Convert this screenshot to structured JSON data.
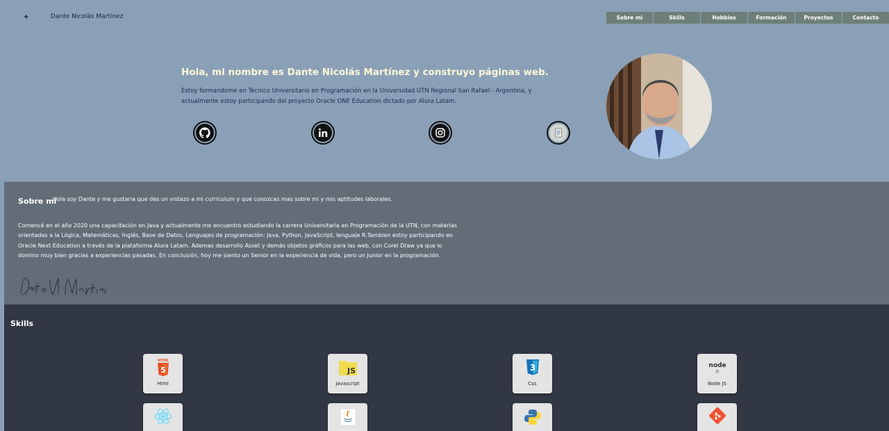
{
  "header": {
    "site_name": "Dante Nicolás Martínez",
    "logo_icon": "sparkle-icon",
    "nav": [
      {
        "label": "Sobre mi"
      },
      {
        "label": "Skills"
      },
      {
        "label": "Hobbies"
      },
      {
        "label": "Formación"
      },
      {
        "label": "Proyectos"
      },
      {
        "label": "Contacto"
      }
    ]
  },
  "hero": {
    "title": "Hola, mi nombre es Dante Nicolás Martínez y construyo páginas web.",
    "text": "Estoy formandome en Tecnico Universitario en Programación en la Universidad UTN Regional San Rafael - Argentina, y actualmente estoy participando del proyecto Oracle ONE Education dictado por Alura Latam.",
    "socials": [
      {
        "icon": "github-icon"
      },
      {
        "icon": "linkedin-icon"
      },
      {
        "icon": "instagram-icon"
      },
      {
        "icon": "resume-icon"
      }
    ],
    "avatar": "profile-photo"
  },
  "about": {
    "heading": "Sobre mi",
    "intro": "Hola soy Dante y me gustaria que des un vistazo a mi curriculum y que conozcas mas sobre mi y mis aptitudes laborales.",
    "body": "Comencé en el año 2020 una capacitación en Java y actualmente me encuentro estudiando la carrera Universitaria en Programación de la UTN, con materias orientadas a la Lógica, Matemáticas, Inglés, Base de Datos, Lenguajes de programación: Java, Python, JavaScript, lenguaje R.Tambien estoy participando en Oracle Next Education a través de la plataforma Alura Latam. Ademas desarrollo Asset y demás objetos gráficos para las web, con Corel Draw ya que lo domino muy bien gracias a experiencias pasadas. En conclusión, hoy me siento un Senior en la experiencia de vida, pero un Junior en la programación.",
    "signature": "Dante N Martinez"
  },
  "skills": {
    "heading": "Skills",
    "items": [
      {
        "label": "Html",
        "icon": "html5-icon"
      },
      {
        "label": "Javascript",
        "icon": "javascript-icon"
      },
      {
        "label": "Css",
        "icon": "css3-icon"
      },
      {
        "label": "Node JS",
        "icon": "nodejs-icon"
      },
      {
        "label": "",
        "icon": "react-icon"
      },
      {
        "label": "",
        "icon": "java-icon"
      },
      {
        "label": "",
        "icon": "python-icon"
      },
      {
        "label": "",
        "icon": "git-icon"
      }
    ]
  },
  "colors": {
    "background": "#8aa0b6",
    "nav": "#6d7f78",
    "about_bg": "#636d78",
    "skills_bg": "#323744",
    "hero_title": "#fdf7d8"
  }
}
